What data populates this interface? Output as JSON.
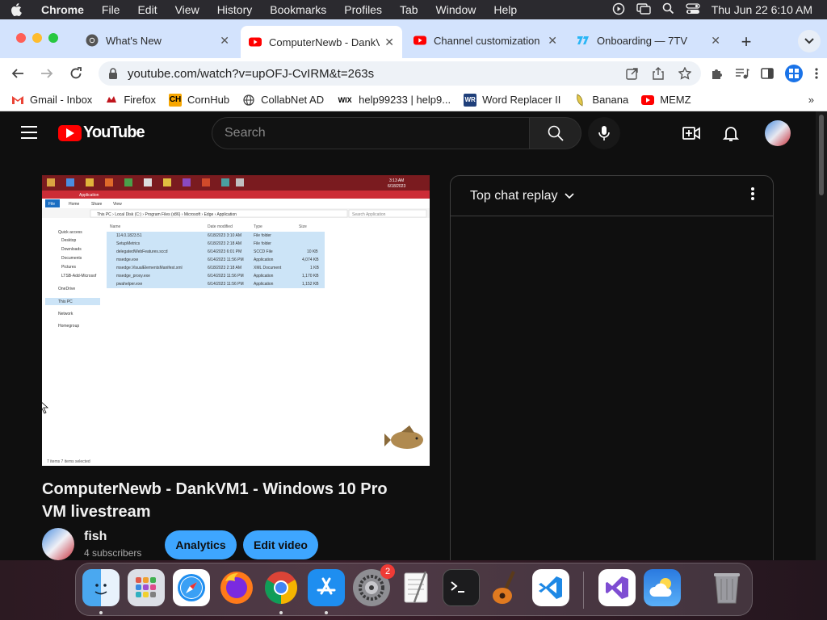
{
  "menubar": {
    "app": "Chrome",
    "items": [
      "File",
      "Edit",
      "View",
      "History",
      "Bookmarks",
      "Profiles",
      "Tab",
      "Window",
      "Help"
    ],
    "clock": "Thu Jun 22  6:10 AM"
  },
  "tabs": [
    {
      "title": "What's New",
      "icon": "chrome-icon"
    },
    {
      "title": "ComputerNewb - DankV",
      "icon": "youtube-icon",
      "active": true
    },
    {
      "title": "Channel customization",
      "icon": "youtube-icon"
    },
    {
      "title": "Onboarding — 7TV",
      "icon": "7tv-icon"
    }
  ],
  "omnibox": {
    "url": "youtube.com/watch?v=upOFJ-CvIRM&t=263s"
  },
  "bookmarks": [
    {
      "label": "Gmail - Inbox",
      "icon": "gmail-icon"
    },
    {
      "label": "Firefox",
      "icon": "firefox-icon"
    },
    {
      "label": "CornHub",
      "icon": "cornhub-icon"
    },
    {
      "label": "CollabNet AD",
      "icon": "globe-icon"
    },
    {
      "label": "help99233 | help9...",
      "icon": "wix-icon"
    },
    {
      "label": "Word Replacer II",
      "icon": "word-replacer-icon"
    },
    {
      "label": "Banana",
      "icon": "banana-icon"
    },
    {
      "label": "MEMZ",
      "icon": "youtube-icon"
    }
  ],
  "youtube": {
    "logo_text": "YouTube",
    "search_placeholder": "Search",
    "video_title": "ComputerNewb - DankVM1 - Windows 10 Pro VM livestream",
    "channel_name": "fish",
    "subscribers": "4 subscribers",
    "buttons": {
      "analytics": "Analytics",
      "edit": "Edit video"
    },
    "chat_header": "Top chat replay"
  },
  "video_frame": {
    "taskbar_time": "3:13 AM",
    "taskbar_date": "6/18/2023",
    "window_title": "Application",
    "ribbon_tabs": [
      "File",
      "Home",
      "Share",
      "View"
    ],
    "path": [
      "This PC",
      "Local Disk (C:)",
      "Program Files (x86)",
      "Microsoft",
      "Edge",
      "Application"
    ],
    "search_placeholder": "Search Application",
    "nav_items": [
      "Quick access",
      "Desktop",
      "Downloads",
      "Documents",
      "Pictures",
      "LTSB-Add-Microsof",
      "OneDrive",
      "This PC",
      "Network",
      "Homegroup"
    ],
    "columns": [
      "Name",
      "Date modified",
      "Type",
      "Size"
    ],
    "files": [
      {
        "name": "114.0.1823.51",
        "date": "6/18/2023 3:10 AM",
        "type": "File folder",
        "size": ""
      },
      {
        "name": "SetupMetrics",
        "date": "6/18/2023 2:18 AM",
        "type": "File folder",
        "size": ""
      },
      {
        "name": "delegatedWebFeatures.sccd",
        "date": "6/14/2023 6:01 PM",
        "type": "SCCD File",
        "size": "10 KB"
      },
      {
        "name": "msedge.exe",
        "date": "6/14/2023 11:56 PM",
        "type": "Application",
        "size": "4,074 KB"
      },
      {
        "name": "msedge.VisualElementsManifest.xml",
        "date": "6/18/2023 2:18 AM",
        "type": "XML Document",
        "size": "1 KB"
      },
      {
        "name": "msedge_proxy.exe",
        "date": "6/14/2023 11:56 PM",
        "type": "Application",
        "size": "1,170 KB"
      },
      {
        "name": "pwahelper.exe",
        "date": "6/14/2023 11:56 PM",
        "type": "Application",
        "size": "1,152 KB"
      }
    ],
    "status": "7 items    7 items selected"
  },
  "dock": {
    "apps": [
      "finder-icon",
      "launchpad-icon",
      "safari-icon",
      "firefox-icon",
      "chrome-icon",
      "app-store-icon",
      "system-settings-icon",
      "textedit-icon",
      "terminal-icon",
      "garageband-icon",
      "vscode-icon",
      "visual-studio-icon",
      "weather-icon",
      "trash-icon"
    ],
    "settings_badge": "2"
  }
}
